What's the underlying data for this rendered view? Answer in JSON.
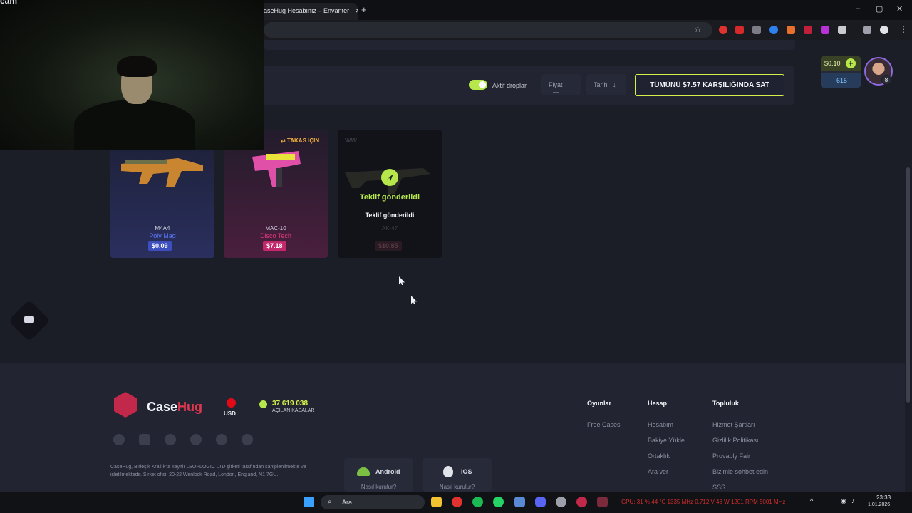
{
  "browser": {
    "tab_title": "aseHug Hesabınız – Envanter",
    "new_tab": "+",
    "controls": {
      "minimize": "–",
      "maximize": "▢",
      "close": "✕"
    },
    "star": "☆",
    "menu": "⋮"
  },
  "filters": {
    "active_drops_label": "Aktif droplar",
    "price_label": "Fiyat",
    "price_icon": "—",
    "date_label": "Tarih",
    "date_icon": "↓",
    "sell_all_label": "TÜMÜNÜ $7.57 KARŞILIĞINDA SAT"
  },
  "wallet": {
    "balance": "$0.10",
    "plus": "+",
    "coins": "615",
    "avatar_level": "8"
  },
  "items": [
    {
      "weapon": "M4A4",
      "skin": "Poly Mag",
      "price": "$0.09",
      "skin_color": "#5c7cff",
      "price_bg": "#3d4fbf"
    },
    {
      "weapon": "MAC-10",
      "skin": "Disco Tech",
      "price": "$7.18",
      "skin_color": "#e0377a",
      "price_bg": "#c2286a",
      "tag": "TAKAS İÇİN"
    },
    {
      "weapon": "AK-47",
      "skin": "",
      "price": "$10.85",
      "status_title": "Teklif gönderildi",
      "status_sub": "Teklif gönderildi",
      "wear": "WW"
    }
  ],
  "footer": {
    "brand_case": "Case",
    "brand_hug": "Hug",
    "currency": "USD",
    "opened_count": "37 619 038",
    "opened_label": "AÇILAN KASALAR",
    "legal": "CaseHug, Birleşik Krallık'ta kayıtlı LEOPLOGIC LTD şirketi tarafından sahiplenilmekte ve işletilmektedir. Şirket ofisi: 20-22 Wenlock Road, London, England, N1 7GU.",
    "android": {
      "label": "Android",
      "how": "Nasıl kurulur?"
    },
    "ios": {
      "label": "IOS",
      "how": "Nasıl kurulur?"
    },
    "columns": [
      {
        "title": "Oyunlar",
        "links": [
          "Free Cases"
        ]
      },
      {
        "title": "Hesap",
        "links": [
          "Hesabım",
          "Bakiye Yükle",
          "Ortaklık",
          "Ara ver"
        ]
      },
      {
        "title": "Topluluk",
        "links": [
          "Hizmet Şartları",
          "Gizlilik Politikası",
          "Provably Fair",
          "Bizimle sohbet edin",
          "SSS"
        ]
      }
    ]
  },
  "taskbar": {
    "search_placeholder": "Ara",
    "sysinfo": "GPU: 31 % 44 °C 1335 MHz 0,712 V 48 W 1201 RPM 5001 MHz",
    "time": "23:33",
    "date": "1.01.2026"
  },
  "webcam_overlay_text": "eam"
}
